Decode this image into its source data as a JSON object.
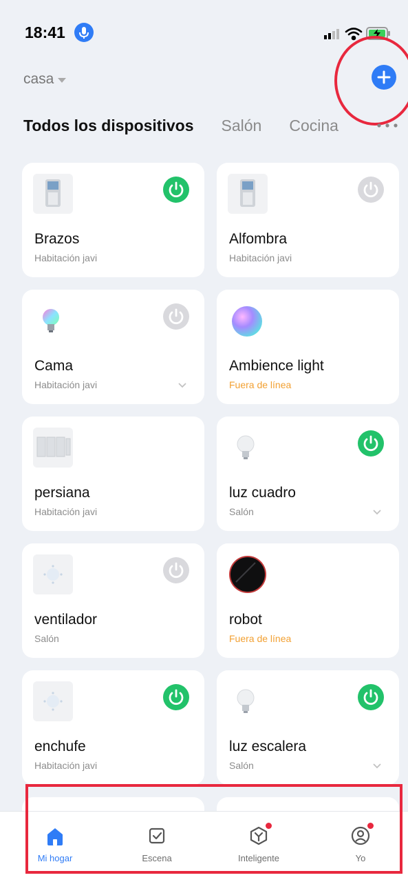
{
  "status_bar": {
    "time": "18:41"
  },
  "header": {
    "home_name": "casa"
  },
  "tabs": [
    {
      "label": "Todos los dispositivos",
      "active": true
    },
    {
      "label": "Salón",
      "active": false
    },
    {
      "label": "Cocina",
      "active": false
    }
  ],
  "devices": [
    {
      "name": "Brazos",
      "room": "Habitación javi",
      "power": "on",
      "icon": "smart-plug-icon"
    },
    {
      "name": "Alfombra",
      "room": "Habitación javi",
      "power": "off",
      "icon": "smart-plug-icon"
    },
    {
      "name": "Cama",
      "room": "Habitación javi",
      "power": "off",
      "icon": "rgb-bulb-icon",
      "expandable": true
    },
    {
      "name": "Ambience light",
      "room": "Fuera de línea",
      "offline": true,
      "icon": "ambience-light-icon"
    },
    {
      "name": "persiana",
      "room": "Habitación javi",
      "icon": "blinds-icon"
    },
    {
      "name": "luz cuadro",
      "room": "Salón",
      "power": "on",
      "icon": "bulb-icon",
      "expandable": true
    },
    {
      "name": "ventilador",
      "room": "Salón",
      "power": "off",
      "icon": "fan-switch-icon"
    },
    {
      "name": "robot",
      "room": "Fuera de línea",
      "offline": true,
      "icon": "robot-vacuum-icon"
    },
    {
      "name": "enchufe",
      "room": "Habitación javi",
      "power": "on",
      "icon": "fan-switch-icon"
    },
    {
      "name": "luz escalera",
      "room": "Salón",
      "power": "on",
      "icon": "bulb-icon",
      "expandable": true
    }
  ],
  "bottom_nav": [
    {
      "label": "Mi hogar",
      "active": true,
      "icon": "home-icon"
    },
    {
      "label": "Escena",
      "active": false,
      "icon": "scene-icon"
    },
    {
      "label": "Inteligente",
      "active": false,
      "icon": "smart-icon",
      "badge": true
    },
    {
      "label": "Yo",
      "active": false,
      "icon": "profile-icon",
      "badge": true
    }
  ],
  "colors": {
    "accent": "#2f7cf6",
    "power_on": "#22c26a",
    "power_off": "#d9d9dd",
    "offline": "#f2a032",
    "annotation": "#e8283e"
  }
}
